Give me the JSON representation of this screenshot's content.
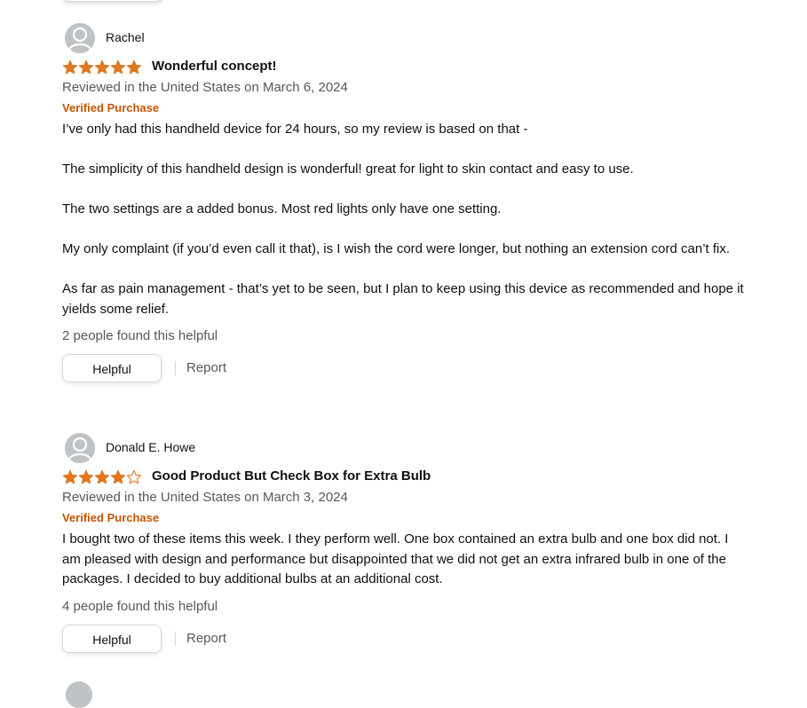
{
  "reviews": [
    {
      "reviewer": "Rachel",
      "rating": 5,
      "max_rating": 5,
      "title": "Wonderful concept!",
      "date": "Reviewed in the United States on March 6, 2024",
      "verified": "Verified Purchase",
      "body": [
        "I’ve only had this handheld device for 24 hours, so my review is based on that -",
        "The simplicity of this handheld design is wonderful! great for light to skin contact and easy to use.",
        "The two settings are a added bonus. Most red lights only have one setting.",
        "My only complaint (if you’d even call it that), is I wish the cord were longer, but nothing an extension cord can’t fix.",
        "As far as pain management - that’s yet to be seen, but I plan to keep using this device as recommended and hope it yields some relief."
      ],
      "helpful_text": "2 people found this helpful",
      "helpful_button": "Helpful",
      "report_label": "Report"
    },
    {
      "reviewer": "Donald E. Howe",
      "rating": 4,
      "max_rating": 5,
      "title": "Good Product But Check Box for Extra Bulb",
      "date": "Reviewed in the United States on March 3, 2024",
      "verified": "Verified Purchase",
      "body": [
        "I bought two of these items this week. I they perform well. One box contained an extra bulb and one box did not. I am pleased with design and performance but disappointed that we did not get an extra infrared bulb in one of the packages. I decided to buy additional bulbs at an additional cost."
      ],
      "helpful_text": "4 people found this helpful",
      "helpful_button": "Helpful",
      "report_label": "Report"
    }
  ],
  "colors": {
    "star_fill": "#de7921",
    "star_outline": "#de7921",
    "verified": "#c45500",
    "secondary_text": "#565959",
    "avatar_bg": "#bfc3c6"
  },
  "icons": {
    "avatar": "user-silhouette-icon",
    "star": "star-icon"
  }
}
